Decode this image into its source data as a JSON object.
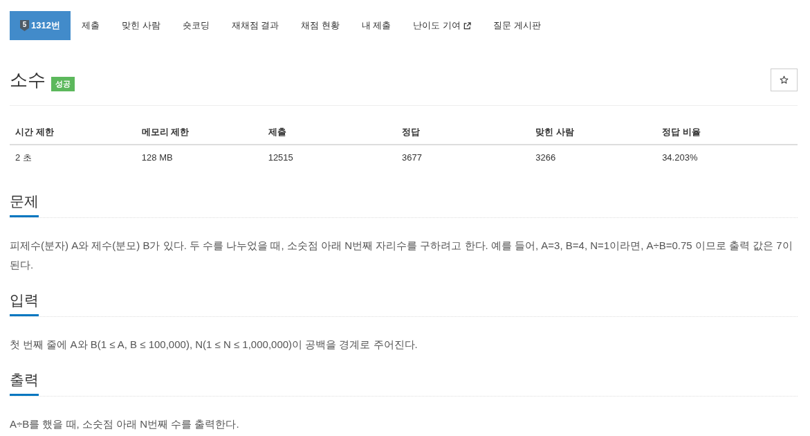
{
  "nav": {
    "tabs": [
      {
        "label": "1312번",
        "tier": "5",
        "selected": true,
        "external": false
      },
      {
        "label": "제출",
        "selected": false,
        "external": false
      },
      {
        "label": "맞힌 사람",
        "selected": false,
        "external": false
      },
      {
        "label": "숏코딩",
        "selected": false,
        "external": false
      },
      {
        "label": "재채점 결과",
        "selected": false,
        "external": false
      },
      {
        "label": "채점 현황",
        "selected": false,
        "external": false
      },
      {
        "label": "내 제출",
        "selected": false,
        "external": false
      },
      {
        "label": "난이도 기여",
        "selected": false,
        "external": true
      },
      {
        "label": "질문 게시판",
        "selected": false,
        "external": false
      }
    ]
  },
  "problem": {
    "title": "소수",
    "status_badge": "성공",
    "starred": false
  },
  "info_table": {
    "columns": [
      "시간 제한",
      "메모리 제한",
      "제출",
      "정답",
      "맞힌 사람",
      "정답 비율"
    ],
    "rows": [
      [
        "2 초",
        "128 MB",
        "12515",
        "3677",
        "3266",
        "34.203%"
      ]
    ]
  },
  "sections": [
    {
      "heading": "문제",
      "paragraphs": [
        "피제수(분자) A와 제수(분모) B가 있다. 두 수를 나누었을 때, 소숫점 아래 N번째 자리수를 구하려고 한다. 예를 들어, A=3, B=4, N=1이라면, A÷B=0.75 이므로 출력 값은 7이 된다."
      ]
    },
    {
      "heading": "입력",
      "paragraphs": [
        "첫 번째 줄에 A와 B(1 ≤ A, B ≤ 100,000), N(1 ≤ N ≤ 1,000,000)이 공백을 경계로 주어진다."
      ]
    },
    {
      "heading": "출력",
      "paragraphs": [
        "A÷B를 했을 때, 소숫점 아래 N번째 수를 출력한다."
      ]
    }
  ]
}
